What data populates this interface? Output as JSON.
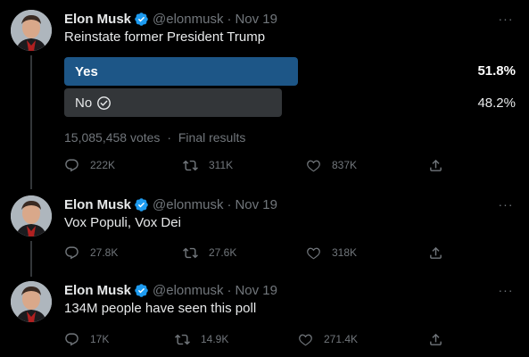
{
  "colors": {
    "background": "#000000",
    "text": "#e7e9ea",
    "muted": "#71767b",
    "verified": "#1d9bf0",
    "poll_winner": "#1d5687",
    "poll_loser": "#333639"
  },
  "tweets": [
    {
      "author": {
        "name": "Elon Musk",
        "handle": "@elonmusk",
        "date": "Nov 19",
        "separator": "·",
        "verified_icon": "verified-badge-icon"
      },
      "text": "Reinstate former President Trump",
      "more_label": "···",
      "poll": {
        "options": [
          {
            "label": "Yes",
            "percent_label": "51.8%",
            "percent": 51.8,
            "winner": true
          },
          {
            "label": "No",
            "percent_label": "48.2%",
            "percent": 48.2,
            "winner": false,
            "voted_icon": "check-circle-icon"
          }
        ],
        "votes": "15,085,458 votes",
        "separator": "·",
        "status": "Final results"
      },
      "actions": {
        "replies": "222K",
        "retweets": "311K",
        "likes": "837K"
      }
    },
    {
      "author": {
        "name": "Elon Musk",
        "handle": "@elonmusk",
        "date": "Nov 19",
        "separator": "·",
        "verified_icon": "verified-badge-icon"
      },
      "text": "Vox Populi, Vox Dei",
      "more_label": "···",
      "actions": {
        "replies": "27.8K",
        "retweets": "27.6K",
        "likes": "318K"
      }
    },
    {
      "author": {
        "name": "Elon Musk",
        "handle": "@elonmusk",
        "date": "Nov 19",
        "separator": "·",
        "verified_icon": "verified-badge-icon"
      },
      "text": "134M people have seen this poll",
      "more_label": "···",
      "actions": {
        "replies": "17K",
        "retweets": "14.9K",
        "likes": "271.4K"
      }
    }
  ]
}
